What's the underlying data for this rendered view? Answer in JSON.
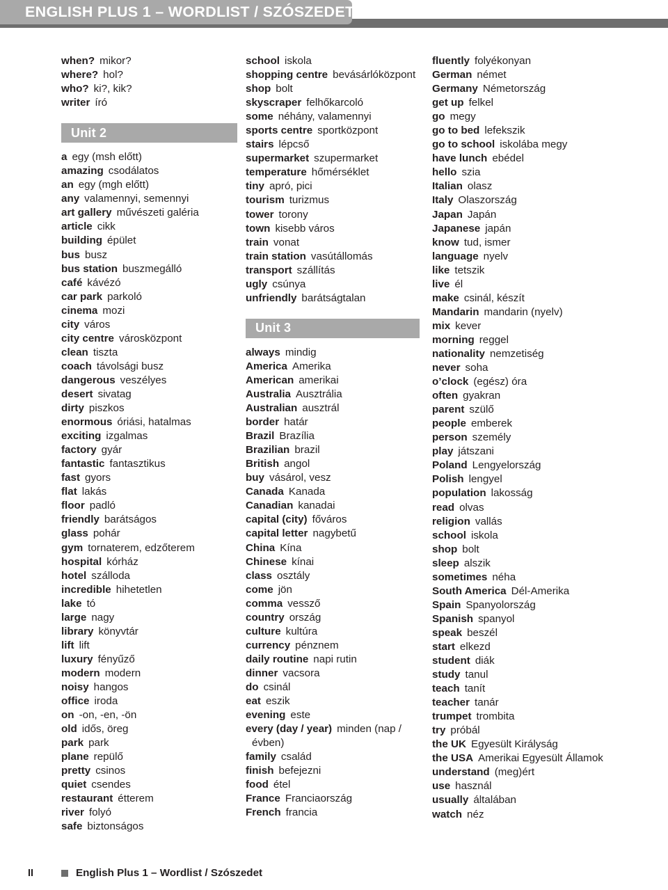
{
  "header": {
    "title": "ENGLISH PLUS 1 – WORDLIST / SZÓSZEDET",
    "bar_color": "#6e6e6e",
    "pill_color": "#a9a9a9",
    "text_color": "#ffffff"
  },
  "footer": {
    "page_number": "II",
    "text": "English Plus 1 – Wordlist / Szószedet",
    "square_color": "#6e6e6e"
  },
  "columns": [
    {
      "id": "column-1",
      "blocks": [
        {
          "type": "entries",
          "items": [
            {
              "en": "when?",
              "hu": "mikor?"
            },
            {
              "en": "where?",
              "hu": "hol?"
            },
            {
              "en": "who?",
              "hu": "ki?, kik?"
            },
            {
              "en": "writer",
              "hu": "író"
            }
          ]
        },
        {
          "type": "unit",
          "label": "Unit 2"
        },
        {
          "type": "entries",
          "items": [
            {
              "en": "a",
              "hu": "egy (msh előtt)"
            },
            {
              "en": "amazing",
              "hu": "csodálatos"
            },
            {
              "en": "an",
              "hu": "egy (mgh előtt)"
            },
            {
              "en": "any",
              "hu": "valamennyi, semennyi"
            },
            {
              "en": "art gallery",
              "hu": "művészeti galéria"
            },
            {
              "en": "article",
              "hu": "cikk"
            },
            {
              "en": "building",
              "hu": "épület"
            },
            {
              "en": "bus",
              "hu": "busz"
            },
            {
              "en": "bus station",
              "hu": "buszmegálló"
            },
            {
              "en": "café",
              "hu": "kávézó"
            },
            {
              "en": "car park",
              "hu": "parkoló"
            },
            {
              "en": "cinema",
              "hu": "mozi"
            },
            {
              "en": "city",
              "hu": "város"
            },
            {
              "en": "city centre",
              "hu": "városközpont"
            },
            {
              "en": "clean",
              "hu": "tiszta"
            },
            {
              "en": "coach",
              "hu": "távolsági busz"
            },
            {
              "en": "dangerous",
              "hu": "veszélyes"
            },
            {
              "en": "desert",
              "hu": "sivatag"
            },
            {
              "en": "dirty",
              "hu": "piszkos"
            },
            {
              "en": "enormous",
              "hu": "óriási, hatalmas"
            },
            {
              "en": "exciting",
              "hu": "izgalmas"
            },
            {
              "en": "factory",
              "hu": "gyár"
            },
            {
              "en": "fantastic",
              "hu": "fantasztikus"
            },
            {
              "en": "fast",
              "hu": "gyors"
            },
            {
              "en": "flat",
              "hu": "lakás"
            },
            {
              "en": "floor",
              "hu": "padló"
            },
            {
              "en": "friendly",
              "hu": "barátságos"
            },
            {
              "en": "glass",
              "hu": "pohár"
            },
            {
              "en": "gym",
              "hu": "tornaterem, edzőterem"
            },
            {
              "en": "hospital",
              "hu": "kórház"
            },
            {
              "en": "hotel",
              "hu": "szálloda"
            },
            {
              "en": "incredible",
              "hu": "hihetetlen"
            },
            {
              "en": "lake",
              "hu": "tó"
            },
            {
              "en": "large",
              "hu": "nagy"
            },
            {
              "en": "library",
              "hu": "könyvtár"
            },
            {
              "en": "lift",
              "hu": "lift"
            },
            {
              "en": "luxury",
              "hu": "fényűző"
            },
            {
              "en": "modern",
              "hu": "modern"
            },
            {
              "en": "noisy",
              "hu": "hangos"
            },
            {
              "en": "office",
              "hu": "iroda"
            },
            {
              "en": "on",
              "hu": "-on, -en, -ön"
            },
            {
              "en": "old",
              "hu": "idős, öreg"
            },
            {
              "en": "park",
              "hu": "park"
            },
            {
              "en": "plane",
              "hu": "repülő"
            },
            {
              "en": "pretty",
              "hu": "csinos"
            },
            {
              "en": "quiet",
              "hu": "csendes"
            },
            {
              "en": "restaurant",
              "hu": "étterem"
            },
            {
              "en": "river",
              "hu": "folyó"
            },
            {
              "en": "safe",
              "hu": "biztonságos"
            }
          ]
        }
      ]
    },
    {
      "id": "column-2",
      "blocks": [
        {
          "type": "entries",
          "items": [
            {
              "en": "school",
              "hu": "iskola"
            },
            {
              "en": "shopping centre",
              "hu": "bevásárlóközpont"
            },
            {
              "en": "shop",
              "hu": "bolt"
            },
            {
              "en": "skyscraper",
              "hu": "felhőkarcoló"
            },
            {
              "en": "some",
              "hu": "néhány, valamennyi"
            },
            {
              "en": "sports centre",
              "hu": "sportközpont"
            },
            {
              "en": "stairs",
              "hu": "lépcső"
            },
            {
              "en": "supermarket",
              "hu": "szupermarket"
            },
            {
              "en": "temperature",
              "hu": "hőmérséklet"
            },
            {
              "en": "tiny",
              "hu": "apró, pici"
            },
            {
              "en": "tourism",
              "hu": "turizmus"
            },
            {
              "en": "tower",
              "hu": "torony"
            },
            {
              "en": "town",
              "hu": "kisebb város"
            },
            {
              "en": "train",
              "hu": "vonat"
            },
            {
              "en": "train station",
              "hu": "vasútállomás"
            },
            {
              "en": "transport",
              "hu": "szállítás"
            },
            {
              "en": "ugly",
              "hu": "csúnya"
            },
            {
              "en": "unfriendly",
              "hu": "barátságtalan"
            }
          ]
        },
        {
          "type": "unit",
          "label": "Unit 3"
        },
        {
          "type": "entries",
          "items": [
            {
              "en": "always",
              "hu": "mindig"
            },
            {
              "en": "America",
              "hu": "Amerika"
            },
            {
              "en": "American",
              "hu": "amerikai"
            },
            {
              "en": "Australia",
              "hu": "Ausztrália"
            },
            {
              "en": "Australian",
              "hu": "ausztrál"
            },
            {
              "en": "border",
              "hu": "határ"
            },
            {
              "en": "Brazil",
              "hu": "Brazília"
            },
            {
              "en": "Brazilian",
              "hu": "brazil"
            },
            {
              "en": "British",
              "hu": "angol"
            },
            {
              "en": "buy",
              "hu": "vásárol, vesz"
            },
            {
              "en": "Canada",
              "hu": "Kanada"
            },
            {
              "en": "Canadian",
              "hu": "kanadai"
            },
            {
              "en": "capital (city)",
              "hu": "főváros"
            },
            {
              "en": "capital letter",
              "hu": "nagybetű"
            },
            {
              "en": "China",
              "hu": "Kína"
            },
            {
              "en": "Chinese",
              "hu": "kínai"
            },
            {
              "en": "class",
              "hu": "osztály"
            },
            {
              "en": "come",
              "hu": "jön"
            },
            {
              "en": "comma",
              "hu": "vessző"
            },
            {
              "en": "country",
              "hu": "ország"
            },
            {
              "en": "culture",
              "hu": "kultúra"
            },
            {
              "en": "currency",
              "hu": "pénznem"
            },
            {
              "en": "daily routine",
              "hu": "napi rutin"
            },
            {
              "en": "dinner",
              "hu": "vacsora"
            },
            {
              "en": "do",
              "hu": "csinál"
            },
            {
              "en": "eat",
              "hu": "eszik"
            },
            {
              "en": "evening",
              "hu": "este"
            },
            {
              "en": "every (day / year)",
              "hu": "minden (nap / évben)"
            },
            {
              "en": "family",
              "hu": "család"
            },
            {
              "en": "finish",
              "hu": "befejezni"
            },
            {
              "en": "food",
              "hu": "étel"
            },
            {
              "en": "France",
              "hu": "Franciaország"
            },
            {
              "en": "French",
              "hu": "francia"
            }
          ]
        }
      ]
    },
    {
      "id": "column-3",
      "blocks": [
        {
          "type": "entries",
          "items": [
            {
              "en": "fluently",
              "hu": "folyékonyan"
            },
            {
              "en": "German",
              "hu": "német"
            },
            {
              "en": "Germany",
              "hu": "Németország"
            },
            {
              "en": "get up",
              "hu": "felkel"
            },
            {
              "en": "go",
              "hu": "megy"
            },
            {
              "en": "go to bed",
              "hu": "lefekszik"
            },
            {
              "en": "go to school",
              "hu": "iskolába megy"
            },
            {
              "en": "have lunch",
              "hu": "ebédel"
            },
            {
              "en": "hello",
              "hu": "szia"
            },
            {
              "en": "Italian",
              "hu": "olasz"
            },
            {
              "en": "Italy",
              "hu": "Olaszország"
            },
            {
              "en": "Japan",
              "hu": "Japán"
            },
            {
              "en": "Japanese",
              "hu": "japán"
            },
            {
              "en": "know",
              "hu": "tud, ismer"
            },
            {
              "en": "language",
              "hu": "nyelv"
            },
            {
              "en": "like",
              "hu": "tetszik"
            },
            {
              "en": "live",
              "hu": "él"
            },
            {
              "en": "make",
              "hu": "csinál, készít"
            },
            {
              "en": "Mandarin",
              "hu": "mandarin (nyelv)"
            },
            {
              "en": "mix",
              "hu": "kever"
            },
            {
              "en": "morning",
              "hu": "reggel"
            },
            {
              "en": "nationality",
              "hu": "nemzetiség"
            },
            {
              "en": "never",
              "hu": "soha"
            },
            {
              "en": "o’clock",
              "hu": "(egész) óra"
            },
            {
              "en": "often",
              "hu": "gyakran"
            },
            {
              "en": "parent",
              "hu": "szülő"
            },
            {
              "en": "people",
              "hu": "emberek"
            },
            {
              "en": "person",
              "hu": "személy"
            },
            {
              "en": "play",
              "hu": "játszani"
            },
            {
              "en": "Poland",
              "hu": "Lengyelország"
            },
            {
              "en": "Polish",
              "hu": "lengyel"
            },
            {
              "en": "population",
              "hu": "lakosság"
            },
            {
              "en": "read",
              "hu": "olvas"
            },
            {
              "en": "religion",
              "hu": "vallás"
            },
            {
              "en": "school",
              "hu": "iskola"
            },
            {
              "en": "shop",
              "hu": "bolt"
            },
            {
              "en": "sleep",
              "hu": "alszik"
            },
            {
              "en": "sometimes",
              "hu": "néha"
            },
            {
              "en": "South America",
              "hu": "Dél-Amerika"
            },
            {
              "en": "Spain",
              "hu": "Spanyolország"
            },
            {
              "en": "Spanish",
              "hu": "spanyol"
            },
            {
              "en": "speak",
              "hu": "beszél"
            },
            {
              "en": "start",
              "hu": "elkezd"
            },
            {
              "en": "student",
              "hu": "diák"
            },
            {
              "en": "study",
              "hu": "tanul"
            },
            {
              "en": "teach",
              "hu": "tanít"
            },
            {
              "en": "teacher",
              "hu": "tanár"
            },
            {
              "en": "trumpet",
              "hu": "trombita"
            },
            {
              "en": "try",
              "hu": "próbál"
            },
            {
              "en": "the UK",
              "hu": "Egyesült Királyság"
            },
            {
              "en": "the USA",
              "hu": "Amerikai Egyesült Államok"
            },
            {
              "en": "understand",
              "hu": "(meg)ért"
            },
            {
              "en": "use",
              "hu": "használ"
            },
            {
              "en": "usually",
              "hu": "általában"
            },
            {
              "en": "watch",
              "hu": "néz"
            }
          ]
        }
      ]
    }
  ]
}
